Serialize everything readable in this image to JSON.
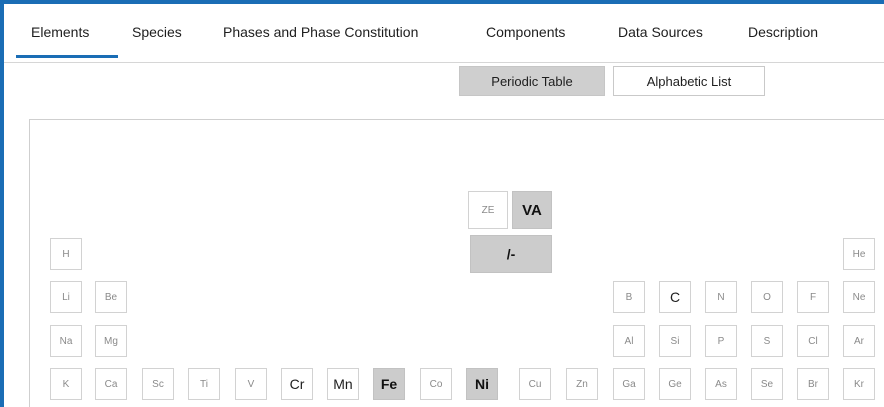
{
  "tabs": [
    {
      "label": "Elements",
      "active": true
    },
    {
      "label": "Species"
    },
    {
      "label": "Phases and Phase Constitution"
    },
    {
      "label": "Components"
    },
    {
      "label": "Data Sources"
    },
    {
      "label": "Description"
    }
  ],
  "view_toggle": {
    "periodic_label": "Periodic Table",
    "alphabetic_label": "Alphabetic List",
    "selected": "Periodic Table"
  },
  "specials": {
    "ze": "ZE",
    "va": "VA",
    "slash": "/-"
  },
  "elements": {
    "H": "H",
    "He": "He",
    "Li": "Li",
    "Be": "Be",
    "B": "B",
    "C": "C",
    "N": "N",
    "O": "O",
    "F": "F",
    "Ne": "Ne",
    "Na": "Na",
    "Mg": "Mg",
    "Al": "Al",
    "Si": "Si",
    "P": "P",
    "S": "S",
    "Cl": "Cl",
    "Ar": "Ar",
    "K": "K",
    "Ca": "Ca",
    "Sc": "Sc",
    "Ti": "Ti",
    "V": "V",
    "Cr": "Cr",
    "Mn": "Mn",
    "Fe": "Fe",
    "Co": "Co",
    "Ni": "Ni",
    "Cu": "Cu",
    "Zn": "Zn",
    "Ga": "Ga",
    "Ge": "Ge",
    "As": "As",
    "Se": "Se",
    "Br": "Br",
    "Kr": "Kr"
  },
  "element_states": {
    "selected": [
      "Fe",
      "Ni",
      "VA",
      "/-"
    ],
    "available": [
      "C",
      "Cr",
      "Mn"
    ]
  },
  "colors": {
    "accent": "#1a6db5",
    "selected_bg": "#cccccc",
    "disabled_text": "#8a8a8a"
  }
}
